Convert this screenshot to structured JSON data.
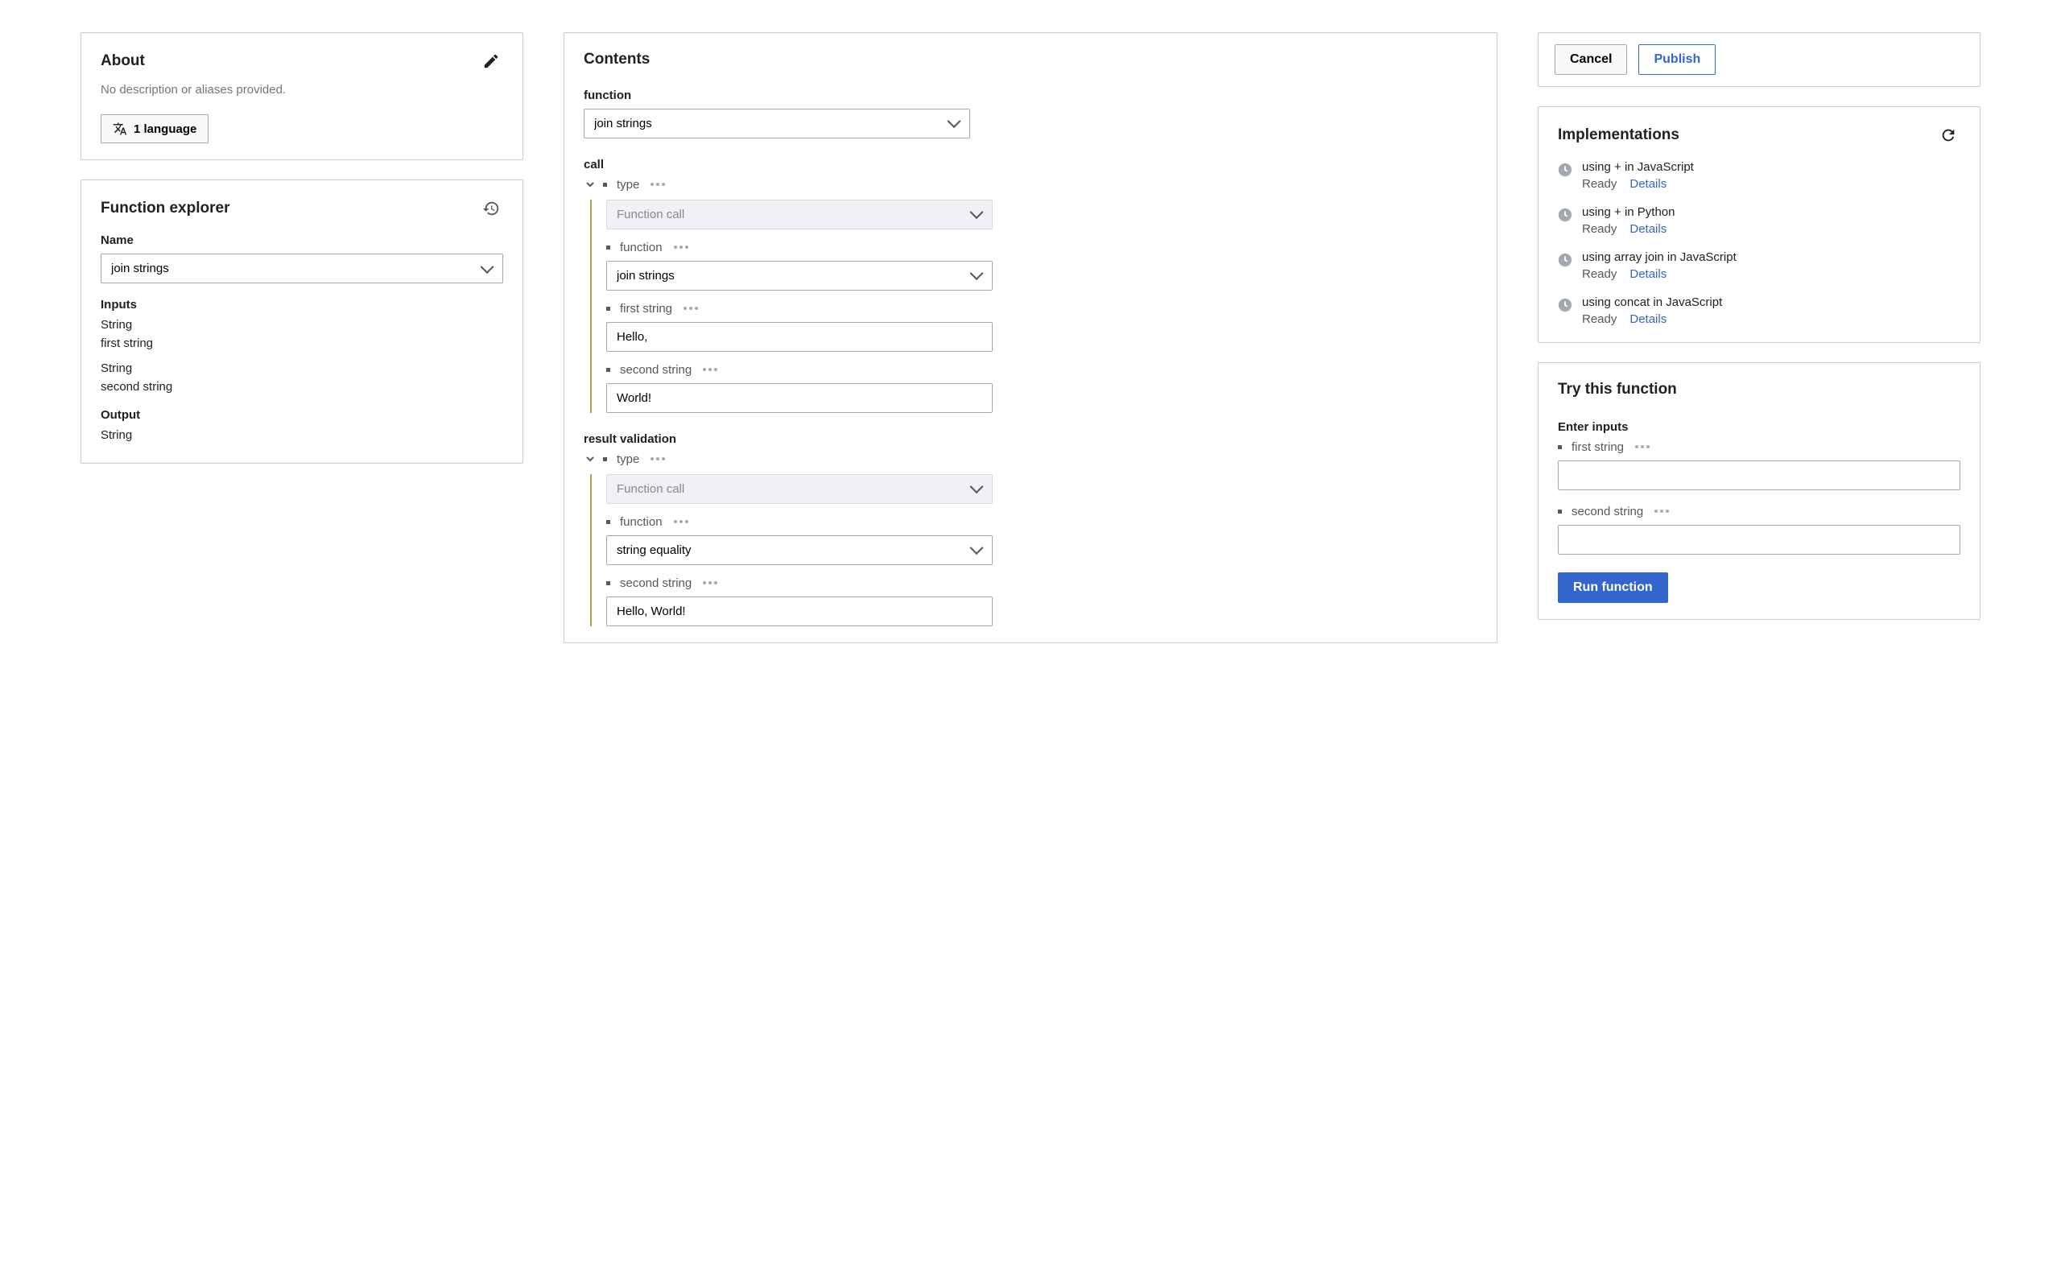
{
  "about": {
    "title": "About",
    "description": "No description or aliases provided.",
    "language_button": "1 language"
  },
  "explorer": {
    "title": "Function explorer",
    "name_label": "Name",
    "name_value": "join strings",
    "inputs_label": "Inputs",
    "inputs": [
      {
        "type": "String",
        "name": "first string"
      },
      {
        "type": "String",
        "name": "second string"
      }
    ],
    "output_label": "Output",
    "output_type": "String"
  },
  "contents": {
    "title": "Contents",
    "function_label": "function",
    "function_value": "join strings",
    "call_label": "call",
    "call": {
      "type_label": "type",
      "type_value": "Function call",
      "function_label": "function",
      "function_value": "join strings",
      "params": [
        {
          "label": "first string",
          "value": "Hello,"
        },
        {
          "label": "second string",
          "value": "World!"
        }
      ]
    },
    "validation_label": "result validation",
    "validation": {
      "type_label": "type",
      "type_value": "Function call",
      "function_label": "function",
      "function_value": "string equality",
      "params": [
        {
          "label": "second string",
          "value": "Hello, World!"
        }
      ]
    }
  },
  "actions": {
    "cancel": "Cancel",
    "publish": "Publish"
  },
  "implementations": {
    "title": "Implementations",
    "items": [
      {
        "name": "using + in JavaScript",
        "status": "Ready",
        "details": "Details"
      },
      {
        "name": "using + in Python",
        "status": "Ready",
        "details": "Details"
      },
      {
        "name": "using array join in JavaScript",
        "status": "Ready",
        "details": "Details"
      },
      {
        "name": "using concat in JavaScript",
        "status": "Ready",
        "details": "Details"
      }
    ]
  },
  "try": {
    "title": "Try this function",
    "inputs_label": "Enter inputs",
    "params": [
      {
        "label": "first string"
      },
      {
        "label": "second string"
      }
    ],
    "run_button": "Run function"
  }
}
